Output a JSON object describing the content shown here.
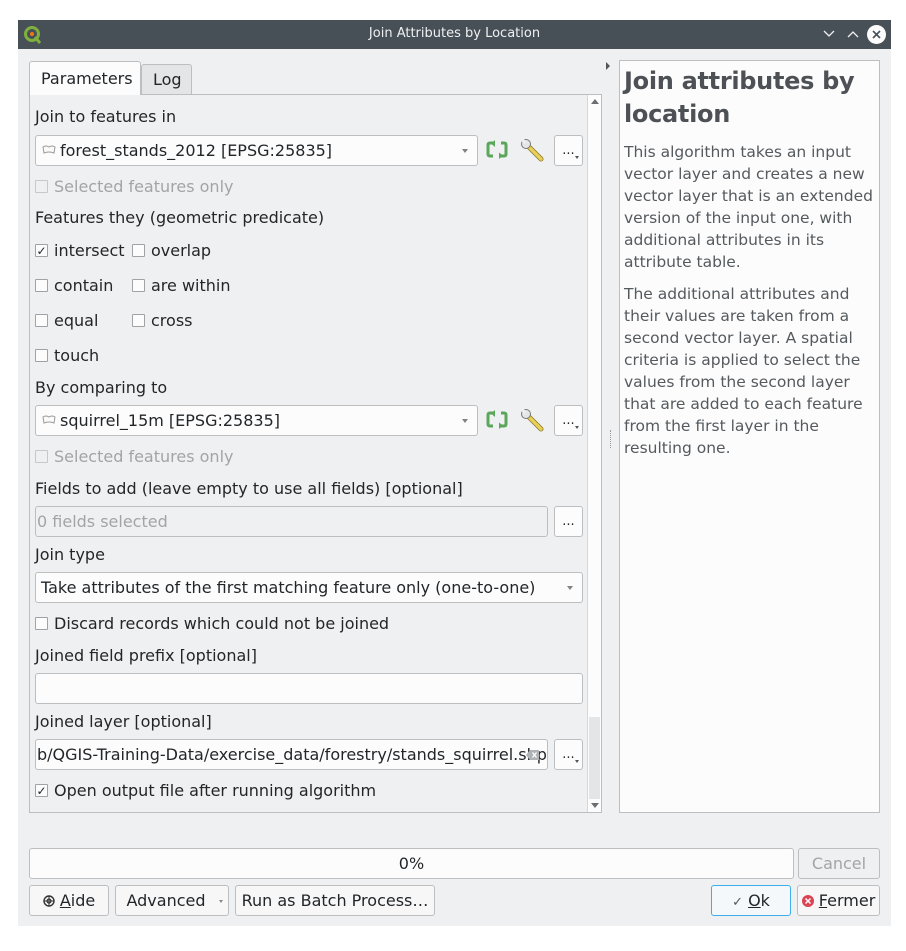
{
  "window": {
    "title": "Join Attributes by Location",
    "controls": [
      "minimize-icon",
      "maximize-icon",
      "close-icon"
    ]
  },
  "tabs": [
    {
      "label": "Parameters",
      "active": true
    },
    {
      "label": "Log",
      "active": false
    }
  ],
  "params": {
    "join_to": {
      "label": "Join to features in",
      "value": "forest_stands_2012 [EPSG:25835]",
      "selected_only_label": "Selected features only",
      "selected_only_checked": false
    },
    "predicate": {
      "label": "Features they (geometric predicate)",
      "options": [
        {
          "label": "intersect",
          "checked": true
        },
        {
          "label": "overlap",
          "checked": false
        },
        {
          "label": "contain",
          "checked": false
        },
        {
          "label": "are within",
          "checked": false
        },
        {
          "label": "equal",
          "checked": false
        },
        {
          "label": "cross",
          "checked": false
        },
        {
          "label": "touch",
          "checked": false
        }
      ]
    },
    "compare_to": {
      "label": "By comparing to",
      "value": "squirrel_15m [EPSG:25835]",
      "selected_only_label": "Selected features only",
      "selected_only_checked": false
    },
    "fields_to_add": {
      "label": "Fields to add (leave empty to use all fields) [optional]",
      "value": "0 fields selected"
    },
    "join_type": {
      "label": "Join type",
      "value": "Take attributes of the first matching feature only (one-to-one)"
    },
    "discard": {
      "label": "Discard records which could not be joined",
      "checked": false
    },
    "prefix": {
      "label": "Joined field prefix [optional]",
      "value": ""
    },
    "joined_layer": {
      "label": "Joined layer [optional]",
      "value": "b/QGIS-Training-Data/exercise_data/forestry/stands_squirrel.shp"
    },
    "open_output": {
      "label": "Open output file after running algorithm",
      "checked": true
    },
    "ellipsis": "..."
  },
  "help": {
    "title": "Join attributes by location",
    "paragraphs": [
      "This algorithm takes an input vector layer and creates a new vector layer that is an extended version of the input one, with additional attributes in its attribute table.",
      "The additional attributes and their values are taken from a second vector layer. A spatial criteria is applied to select the values from the second layer that are added to each feature from the first layer in the resulting one."
    ]
  },
  "footer": {
    "progress_text": "0%",
    "progress_value": 0,
    "cancel_label": "Cancel",
    "help_label_mnemonic": "A",
    "help_label_rest": "ide",
    "advanced_label": "Advanced",
    "batch_label": "Run as Batch Process…",
    "ok_mnemonic": "O",
    "ok_rest": "k",
    "close_mnemonic": "F",
    "close_rest": "ermer"
  },
  "colors": {
    "titlebar": "#475057",
    "accent": "#3daee9",
    "refresh_icon": "#5aa65a",
    "close_red": "#da4453"
  }
}
